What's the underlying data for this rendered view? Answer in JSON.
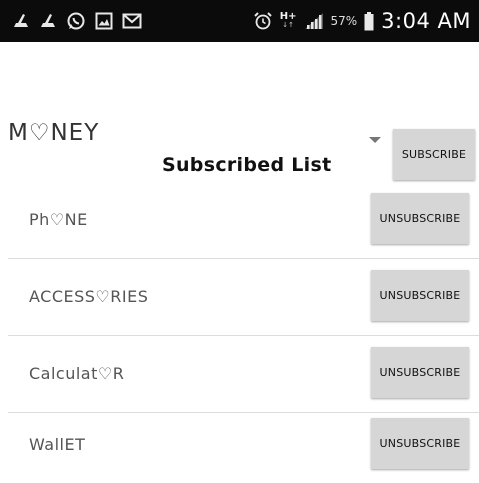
{
  "statusbar": {
    "icons": [
      "notification-sweep-icon",
      "notification-sweep-icon",
      "whatsapp-icon",
      "gallery-icon",
      "gmail-icon"
    ],
    "alarm_icon": "alarm-icon",
    "network_type": "H+",
    "signal_icon": "signal-bars-icon",
    "battery_percent": "57%",
    "battery_icon": "battery-icon",
    "time": "3:04 AM"
  },
  "category_spinner": {
    "selected": "M♡NEY",
    "arrow_icon": "dropdown-triangle-icon"
  },
  "subscribe_button_label": "SUBSCRIBE",
  "list_title": "Subscribed List",
  "subscribed_items": [
    {
      "label": "Ph♡NE",
      "button": "UNSUBSCRIBE"
    },
    {
      "label": "ACCESS♡RIES",
      "button": "UNSUBSCRIBE"
    },
    {
      "label": "Calculat♡R",
      "button": "UNSUBSCRIBE"
    },
    {
      "label": "WallET",
      "button": "UNSUBSCRIBE"
    }
  ],
  "colors": {
    "statusbar_bg": "#0b0b0b",
    "button_bg": "#d6d6d6",
    "divider": "#dcdcdc",
    "page_bg": "#ffffff"
  }
}
